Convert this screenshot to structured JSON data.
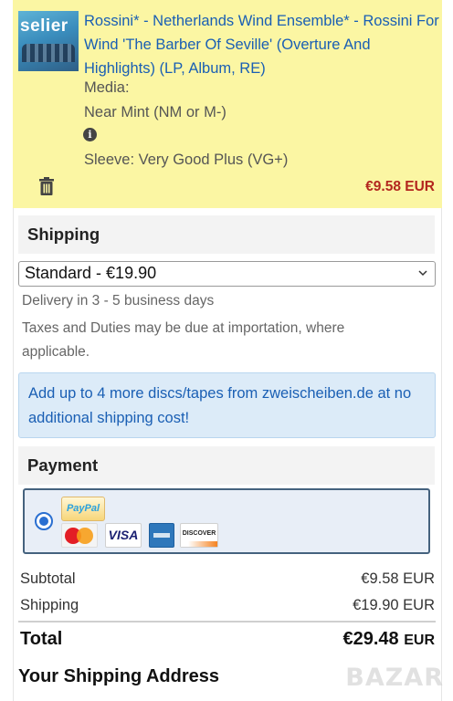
{
  "cart_item": {
    "cover_text": "selier",
    "title": "Rossini* - Netherlands Wind Ensemble* - Rossini For Wind 'The Barber Of Seville' (Overture And Highlights) (LP, Album, RE)",
    "media_label": "Media:",
    "media_condition": "Near Mint (NM or M-)",
    "sleeve": "Sleeve: Very Good Plus (VG+)",
    "price": "€9.58 EUR",
    "icons": {
      "info": "info-icon",
      "delete": "trash-icon"
    }
  },
  "shipping": {
    "heading": "Shipping",
    "selected_option": "Standard - €19.90",
    "delivery": "Delivery in 3 - 5 business days",
    "taxes_note": "Taxes and Duties may be due at importation, where applicable.",
    "promo": "Add up to 4 more discs/tapes from zweischeiben.de at no additional shipping cost!"
  },
  "payment": {
    "heading": "Payment",
    "paypal_logo_text": "PayPal",
    "card_logos": [
      "mastercard",
      "visa",
      "american-express",
      "discover"
    ],
    "visa_text": "VISA",
    "discover_text": "DISCOVER"
  },
  "summary": {
    "subtotal_label": "Subtotal",
    "subtotal_value": "€9.58 EUR",
    "shipping_label": "Shipping",
    "shipping_value": "€19.90 EUR",
    "total_label": "Total",
    "total_amount": "€29.48",
    "total_currency": "EUR"
  },
  "address": {
    "heading": "Your Shipping Address"
  },
  "watermark": "BAZAR",
  "colors": {
    "item_bg": "#fbf6a3",
    "link": "#1a5fb4",
    "price": "#b3261e",
    "promo_bg": "#dcebf8",
    "radio": "#2a6fd1"
  }
}
